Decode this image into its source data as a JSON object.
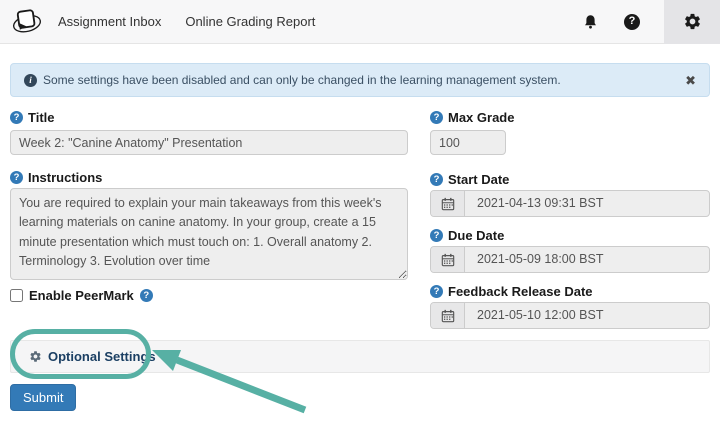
{
  "navbar": {
    "links": [
      {
        "label": "Assignment Inbox"
      },
      {
        "label": "Online Grading Report"
      }
    ]
  },
  "alert": {
    "text": "Some settings have been disabled and can only be changed in the learning management system."
  },
  "form": {
    "title": {
      "label": "Title",
      "value": "Week 2: \"Canine Anatomy\" Presentation"
    },
    "max_grade": {
      "label": "Max Grade",
      "value": "100"
    },
    "instructions": {
      "label": "Instructions",
      "value": "You are required to explain your main takeaways from this week's learning materials on canine anatomy. In your group, create a 15 minute presentation which must touch on: 1. Overall anatomy 2. Terminology 3. Evolution over time"
    },
    "start_date": {
      "label": "Start Date",
      "value": "2021-04-13 09:31 BST"
    },
    "due_date": {
      "label": "Due Date",
      "value": "2021-05-09 18:00 BST"
    },
    "feedback_release_date": {
      "label": "Feedback Release Date",
      "value": "2021-05-10 12:00 BST"
    },
    "enable_peermark": {
      "label": "Enable PeerMark",
      "checked": false
    },
    "optional_settings": {
      "label": "Optional Settings"
    },
    "submit": {
      "label": "Submit"
    }
  },
  "icons": {
    "question_glyph": "?",
    "info_glyph": "i",
    "close_glyph": "✖"
  },
  "colors": {
    "accent_teal": "#57b0a4",
    "alert_bg": "#dcebf7",
    "submit_blue": "#337ab7",
    "help_icon_blue": "#337ab7",
    "navbar_bg": "#f7f7f8",
    "active_tool_bg": "#e4e4e7"
  }
}
